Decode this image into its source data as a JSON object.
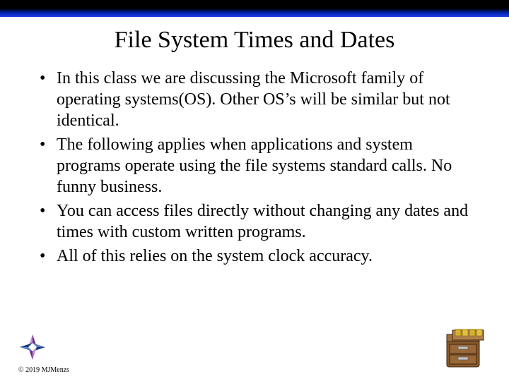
{
  "title": "File System Times and Dates",
  "bullets": [
    "In this class we are discussing the Microsoft family of operating systems(OS). Other OS’s will be similar but not identical.",
    "The following applies when applications and system programs operate using the file systems standard calls. No funny business.",
    "You can access files directly without changing any dates and times with custom written programs.",
    "All of this relies on the system clock accuracy."
  ],
  "copyright": "© 2019 MJMenzs"
}
